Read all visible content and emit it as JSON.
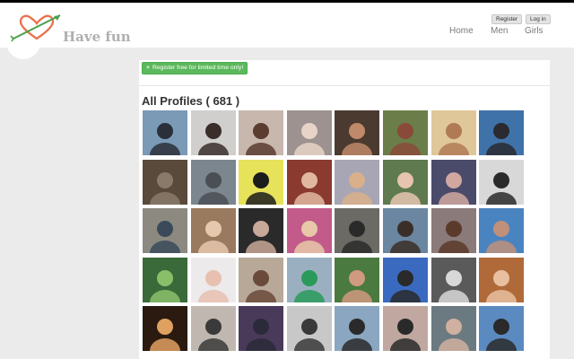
{
  "header": {
    "brand": "Have fun",
    "register_label": "Register",
    "login_label": "Log in",
    "nav": [
      {
        "label": "Home"
      },
      {
        "label": "Men"
      },
      {
        "label": "Girls"
      }
    ]
  },
  "main": {
    "register_promo": "Register free for limited time only!",
    "title": "All Profiles ( 681 )"
  },
  "colors": {
    "accent_green": "#5cb85c",
    "logo_heart": "#e8744f",
    "logo_arrow": "#4aa04a"
  },
  "profiles": [
    {
      "bg": "#7a9ab6",
      "fg": "#2b2f3a"
    },
    {
      "bg": "#d0cfcd",
      "fg": "#3a2e2a"
    },
    {
      "bg": "#c8b7ac",
      "fg": "#5a3c30"
    },
    {
      "bg": "#9d9290",
      "fg": "#e7d3c8"
    },
    {
      "bg": "#4b3a30",
      "fg": "#c08a6a"
    },
    {
      "bg": "#6b7d48",
      "fg": "#8a4a3a"
    },
    {
      "bg": "#e0c79a",
      "fg": "#b07a55"
    },
    {
      "bg": "#3f72a8",
      "fg": "#2a2a30"
    },
    {
      "bg": "#5a4a3c",
      "fg": "#8a7a6a"
    },
    {
      "bg": "#7b868f",
      "fg": "#4a4f55"
    },
    {
      "bg": "#e6e25a",
      "fg": "#1c1c1c"
    },
    {
      "bg": "#8a3a2e",
      "fg": "#e0b8a0"
    },
    {
      "bg": "#a8a6b4",
      "fg": "#d8b08a"
    },
    {
      "bg": "#5e7a4e",
      "fg": "#e6c4b0"
    },
    {
      "bg": "#4a4a6a",
      "fg": "#d0a8a0"
    },
    {
      "bg": "#d8d8d8",
      "fg": "#2a2a2a"
    },
    {
      "bg": "#8c8a80",
      "fg": "#3a4a5a"
    },
    {
      "bg": "#9a7a5e",
      "fg": "#e6c8ae"
    },
    {
      "bg": "#2a2a2a",
      "fg": "#c8a898"
    },
    {
      "bg": "#c25a8a",
      "fg": "#e8c8a8"
    },
    {
      "bg": "#6b6a64",
      "fg": "#2a2a2a"
    },
    {
      "bg": "#6a86a0",
      "fg": "#3a2e28"
    },
    {
      "bg": "#8a7a7a",
      "fg": "#5a3a2a"
    },
    {
      "bg": "#4a84c0",
      "fg": "#c0907a"
    },
    {
      "bg": "#3a6a3a",
      "fg": "#8abf6a"
    },
    {
      "bg": "#eceaea",
      "fg": "#e8c0b0"
    },
    {
      "bg": "#b8a898",
      "fg": "#6a4a3a"
    },
    {
      "bg": "#9ab0c0",
      "fg": "#2a9a5a"
    },
    {
      "bg": "#4a7a40",
      "fg": "#d09a80"
    },
    {
      "bg": "#3a6ac0",
      "fg": "#2a2a2a"
    },
    {
      "bg": "#5a5a5a",
      "fg": "#d8d8d8"
    },
    {
      "bg": "#b06a3a",
      "fg": "#e8c0a0"
    },
    {
      "bg": "#2a1a10",
      "fg": "#e0a060"
    },
    {
      "bg": "#c0b8b0",
      "fg": "#3a3a3a"
    },
    {
      "bg": "#4a3a5a",
      "fg": "#2a2a3a"
    },
    {
      "bg": "#c8c8c8",
      "fg": "#3a3a3a"
    },
    {
      "bg": "#8aa6c0",
      "fg": "#2a2a2a"
    },
    {
      "bg": "#c0a8a0",
      "fg": "#2a2a2a"
    },
    {
      "bg": "#6a7a80",
      "fg": "#d0b0a0"
    },
    {
      "bg": "#5a8ac0",
      "fg": "#2a2a2a"
    }
  ]
}
